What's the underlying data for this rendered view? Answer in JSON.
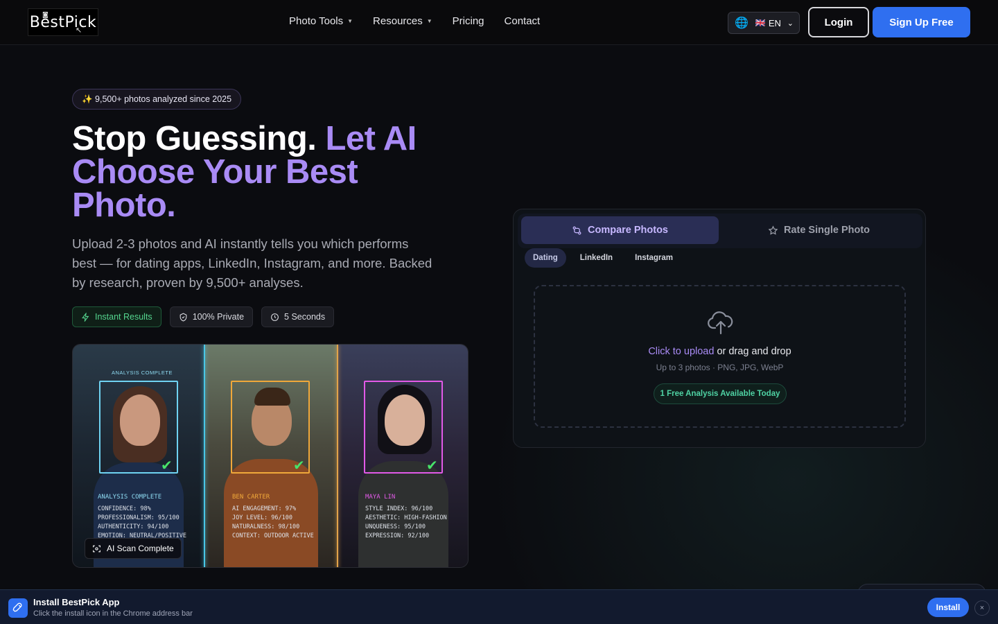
{
  "header": {
    "logo_text": "BestPick",
    "nav": [
      {
        "label": "Photo Tools",
        "has_dropdown": true
      },
      {
        "label": "Resources",
        "has_dropdown": true
      },
      {
        "label": "Pricing",
        "has_dropdown": false
      },
      {
        "label": "Contact",
        "has_dropdown": false
      }
    ],
    "language": {
      "flag": "🇬🇧",
      "code": "EN"
    },
    "login_label": "Login",
    "signup_label": "Sign Up Free"
  },
  "hero": {
    "badge": "✨ 9,500+ photos analyzed since 2025",
    "title_plain": "Stop Guessing.",
    "title_accent_1": "Let AI",
    "title_accent_2": "Choose Your Best",
    "title_accent_3": "Photo.",
    "subtitle": "Upload 2-3 photos and AI instantly tells you which performs best — for dating apps, LinkedIn, Instagram, and more. Backed by research, proven by 9,500+ analyses.",
    "chips": [
      {
        "label": "Instant Results",
        "icon": "bolt-icon"
      },
      {
        "label": "100% Private",
        "icon": "shield-icon"
      },
      {
        "label": "5 Seconds",
        "icon": "clock-icon"
      }
    ],
    "image": {
      "top_label": "ANALYSIS COMPLETE",
      "panels": [
        {
          "title": "ANALYSIS COMPLETE",
          "lines": [
            "CONFIDENCE: 98%",
            "PROFESSIONALISM: 95/100",
            "AUTHENTICITY: 94/100",
            "EMOTION: NEUTRAL/POSITIVE"
          ]
        },
        {
          "title": "BEN CARTER",
          "lines": [
            "AI ENGAGEMENT: 97%",
            "JOY LEVEL: 96/100",
            "NATURALNESS: 98/100",
            "CONTEXT: OUTDOOR ACTIVE"
          ]
        },
        {
          "title": "MAYA LIN",
          "lines": [
            "STYLE INDEX: 96/100",
            "AESTHETIC: HIGH-FASHION",
            "UNQUENESS: 95/100",
            "EXPRESSION: 92/100"
          ]
        }
      ],
      "scan_badge": "AI Scan Complete"
    }
  },
  "card": {
    "tabs": [
      {
        "label": "Compare Photos",
        "icon": "compare-icon",
        "active": true
      },
      {
        "label": "Rate Single Photo",
        "icon": "star-icon",
        "active": false
      }
    ],
    "categories": [
      "Dating",
      "LinkedIn",
      "Instagram"
    ],
    "selected_category": "Dating",
    "upload": {
      "link_text": "Click to upload",
      "rest_text": " or drag and drop",
      "hint": "Up to 3 photos · PNG, JPG, WebP",
      "free_pill": "1 Free Analysis Available Today"
    }
  },
  "install_bar": {
    "title": "Install BestPick App",
    "subtitle": "Click the install icon in the Chrome address bar",
    "button_label": "Install",
    "close_symbol": "×"
  },
  "colors": {
    "accent": "#a98bf5",
    "primary_blue": "#2f6ff0",
    "success_green": "#55d68f",
    "background": "#0b0c10"
  }
}
